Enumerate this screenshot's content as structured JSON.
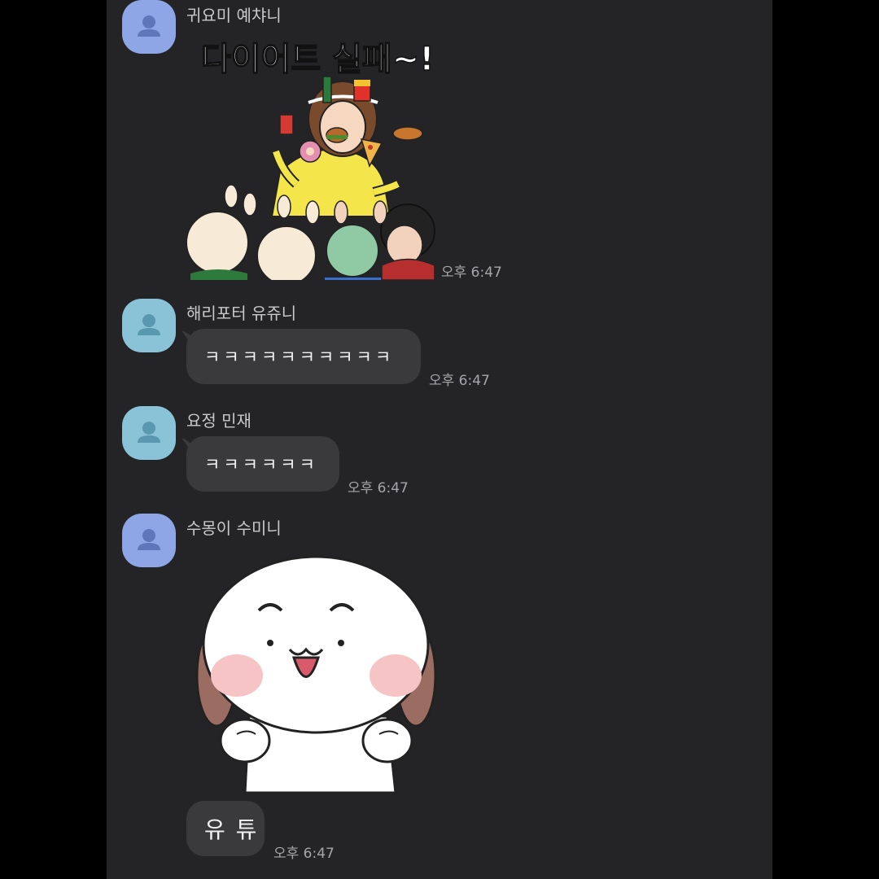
{
  "colors": {
    "background": "#242426",
    "bubble": "#3a3a3d",
    "avatar_blue": "#8ea6e6",
    "avatar_teal": "#8ac3d8"
  },
  "messages": [
    {
      "sender": "귀요미 예챠니",
      "avatar_color": "#8ea6e6",
      "sticker": "diet-fail-sticker",
      "sticker_text": "다이어트 실패~!",
      "time": "오후 6:47"
    },
    {
      "sender": "해리포터 유쥬니",
      "avatar_color": "#8ac3d8",
      "text": "ㅋㅋㅋㅋㅋㅋㅋㅋㅋㅋ",
      "time": "오후 6:47"
    },
    {
      "sender": "요정 민재",
      "avatar_color": "#8ac3d8",
      "text": "ㅋㅋㅋㅋㅋㅋ",
      "time": "오후 6:47"
    },
    {
      "sender": "수몽이 수미니",
      "avatar_color": "#8ea6e6",
      "sticker": "happy-puppy-sticker",
      "text": "유 튜",
      "time": "오후 6:47"
    }
  ]
}
